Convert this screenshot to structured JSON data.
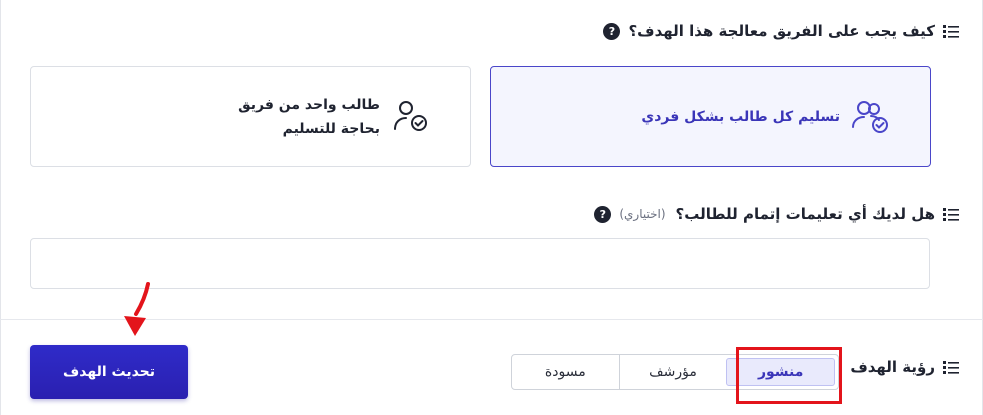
{
  "question1": {
    "text": "كيف يجب على الفريق معالجة هذا الهدف؟",
    "help_glyph": "?",
    "options": [
      {
        "label": "تسليم كل طالب بشكل فردي",
        "icon": "users-check-icon",
        "selected": true
      },
      {
        "label": "طالب واحد من فريق بحاجة للتسليم",
        "icon": "user-check-icon",
        "selected": false
      }
    ]
  },
  "question2": {
    "text": "هل لديك أي تعليمات إتمام للطالب؟",
    "optional": "(اختياري)",
    "help_glyph": "?",
    "input_value": ""
  },
  "visibility": {
    "label": "رؤية الهدف",
    "options": [
      "منشور",
      "مؤرشف",
      "مسودة"
    ],
    "selected": "منشور"
  },
  "update_button": "تحديث الهدف",
  "colors": {
    "accent": "#3a35b8",
    "annotation": "#e3141b"
  }
}
